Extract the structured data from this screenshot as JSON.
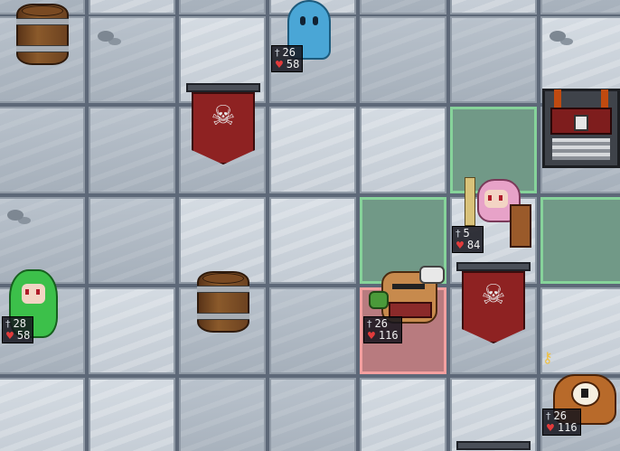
{
  "units": {
    "ghost": {
      "attack": "26",
      "health": "58",
      "icon": "ghost-icon"
    },
    "elf": {
      "attack": "28",
      "health": "58",
      "icon": "green-haired-elf-icon"
    },
    "ogre": {
      "attack": "26",
      "health": "116",
      "icon": "ogre-warrior-icon"
    },
    "priestess": {
      "attack": "5",
      "health": "84",
      "icon": "pink-haired-priestess-icon"
    },
    "golem": {
      "attack": "26",
      "health": "116",
      "icon": "one-eyed-golem-icon"
    }
  },
  "objects": {
    "barrel_icon": "barrel-icon",
    "banner_icon": "skull-banner-icon",
    "chest_icon": "locked-chest-icon",
    "key_icon": "key-icon"
  },
  "glyphs": {
    "sword": "†",
    "heart": "♥",
    "skull": "☠",
    "key": "⚷"
  },
  "colors": {
    "move_highlight": "#86d39a",
    "selected_highlight": "#f4a0a0",
    "banner_red": "#8e2222"
  }
}
